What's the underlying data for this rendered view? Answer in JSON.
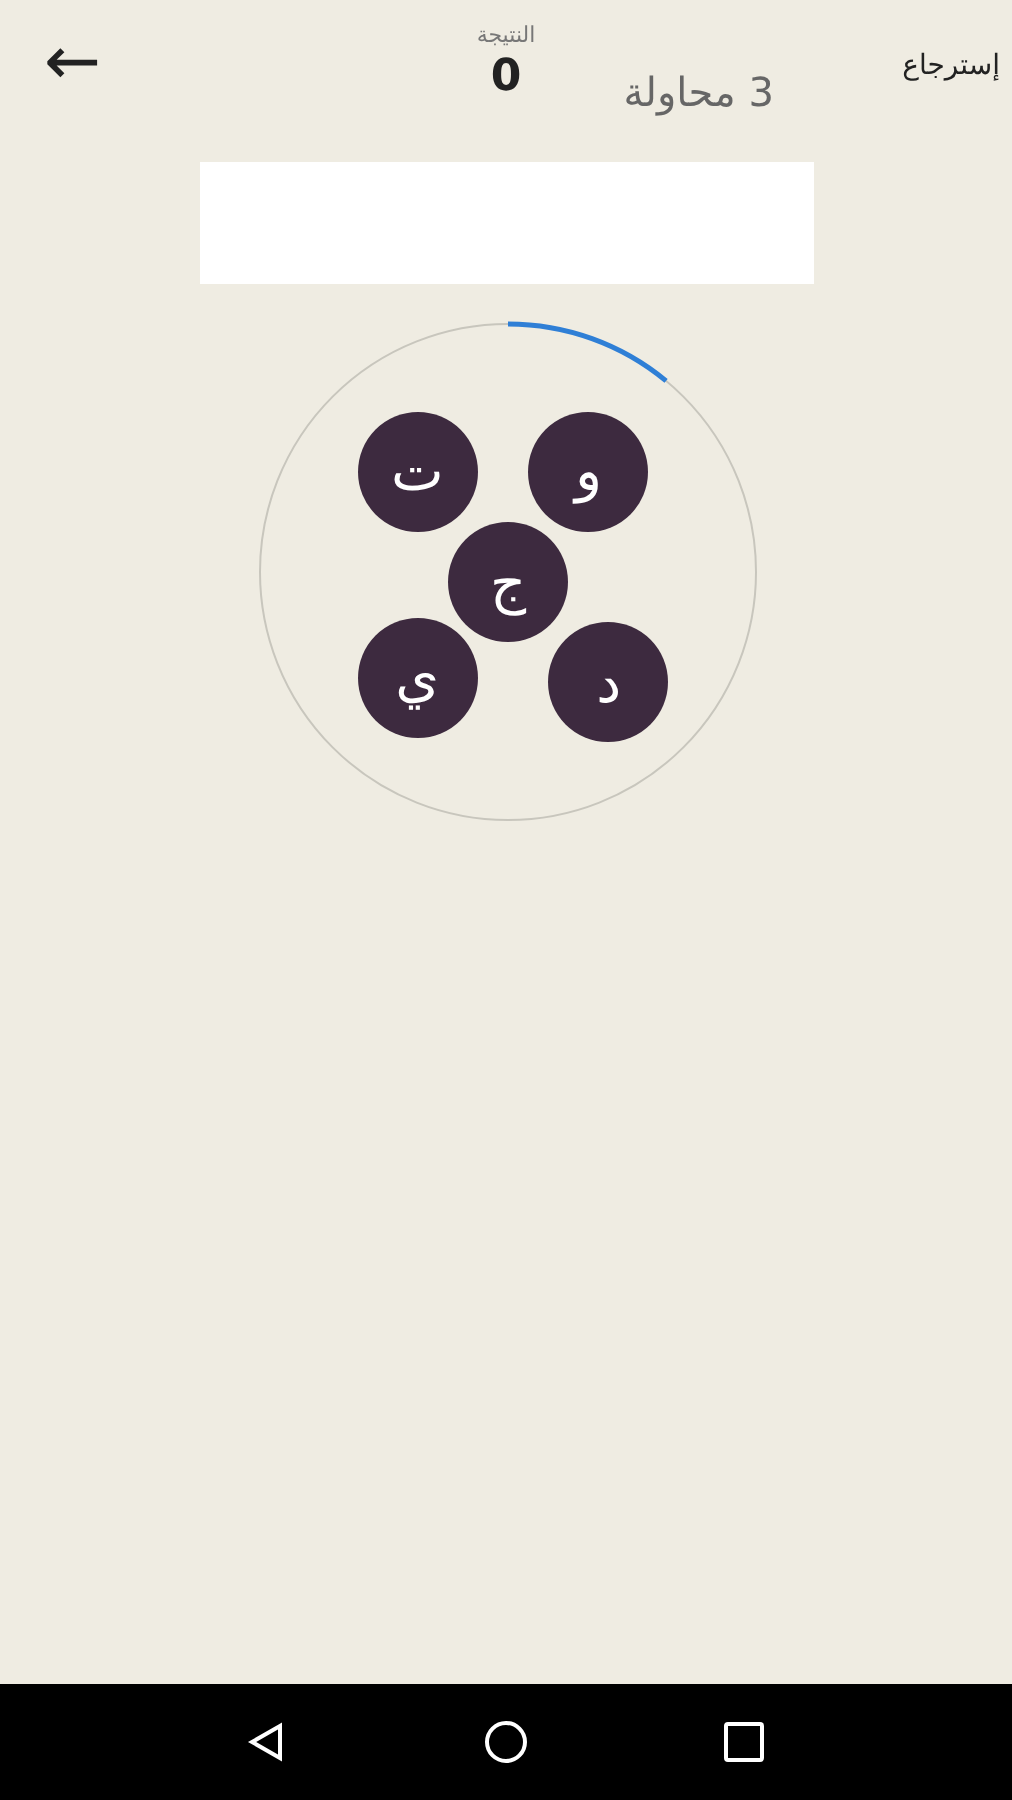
{
  "header": {
    "back_icon": "←",
    "score_label": "النتيجة",
    "score": "0",
    "attempts": "3 محاولة",
    "restore": "إسترجاع"
  },
  "wheel": {
    "letters": [
      {
        "char": "ت"
      },
      {
        "char": "و"
      },
      {
        "char": "ج"
      },
      {
        "char": "ي"
      },
      {
        "char": "د"
      }
    ]
  },
  "nav_bar": {
    "buttons": [
      {
        "kind": "back"
      },
      {
        "kind": "home"
      },
      {
        "kind": "recents"
      }
    ]
  }
}
